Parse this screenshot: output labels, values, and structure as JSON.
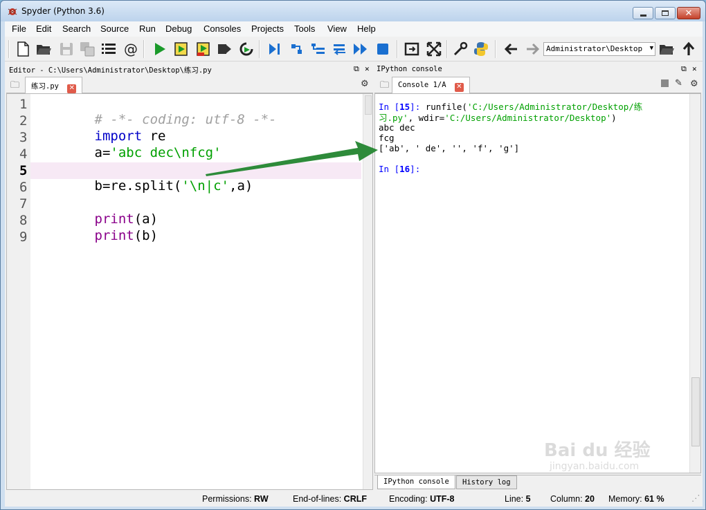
{
  "window": {
    "title": "Spyder (Python 3.6)"
  },
  "menubar": {
    "items": [
      "File",
      "Edit",
      "Search",
      "Source",
      "Run",
      "Debug",
      "Consoles",
      "Projects",
      "Tools",
      "View",
      "Help"
    ]
  },
  "toolbar": {
    "icons": [
      "new-file-icon",
      "open-file-icon",
      "save-icon",
      "save-all-icon",
      "outline-icon",
      "email-icon",
      "run-icon",
      "run-cell-icon",
      "run-cell-advance-icon",
      "run-selection-icon",
      "rerun-icon",
      "debug-icon",
      "step-icon",
      "step-into-icon",
      "step-return-icon",
      "continue-icon",
      "stop-debug-icon",
      "maximize-pane-icon",
      "fullscreen-icon",
      "preferences-icon",
      "python-path-icon",
      "back-icon",
      "forward-icon",
      "browse-icon",
      "parent-dir-icon"
    ],
    "working_dir": "Administrator\\Desktop"
  },
  "editor": {
    "header": "Editor - C:\\Users\\Administrator\\Desktop\\练习.py",
    "tab_label": "练习.py",
    "current_line": 5,
    "line_numbers": [
      "1",
      "2",
      "3",
      "4",
      "5",
      "6",
      "7",
      "8",
      "9"
    ],
    "lines": {
      "l1": "# -*- coding: utf-8 -*-",
      "l2_kw": "import",
      "l2_rest": " re",
      "l3_var": "a=",
      "l3_str": "'abc dec\\nfcg'",
      "l5_a": "b=re.split(",
      "l5_str": "'\\n|c'",
      "l5_b": ",a)",
      "l7_kw": "print",
      "l7_rest": "(a)",
      "l8_kw": "print",
      "l8_rest": "(b)"
    }
  },
  "console": {
    "header": "IPython console",
    "tab_label": "Console 1/A",
    "lines": {
      "in15_prefix": "In [",
      "in15_num": "15",
      "in15_suffix": "]: ",
      "in15_cmd": "runfile(",
      "in15_path1": "'C:/Users/Administrator/Desktop/练",
      "in15_path2": "习.py'",
      "in15_mid": ", wdir=",
      "in15_wdir": "'C:/Users/Administrator/Desktop'",
      "in15_end": ")",
      "out1": "abc dec",
      "out2": "fcg",
      "out3": "['ab', ' de', '', 'f', 'g']",
      "in16_prefix": "In [",
      "in16_num": "16",
      "in16_suffix": "]:"
    },
    "bottom_tabs": [
      "IPython console",
      "History log"
    ]
  },
  "statusbar": {
    "permissions_label": "Permissions:",
    "permissions_value": "RW",
    "eol_label": "End-of-lines:",
    "eol_value": "CRLF",
    "encoding_label": "Encoding:",
    "encoding_value": "UTF-8",
    "line_label": "Line:",
    "line_value": "5",
    "column_label": "Column:",
    "column_value": "20",
    "memory_label": "Memory:",
    "memory_value": "61 %"
  },
  "watermark": {
    "brand": "Bai du 经验",
    "url": "jingyan.baidu.com"
  },
  "colors": {
    "keyword": "#8a008a",
    "string": "#00a000",
    "comment": "#a0a0a0",
    "prompt": "#0000ff",
    "arrow": "#2e8b3a",
    "current_line": "#f7e9f5"
  }
}
